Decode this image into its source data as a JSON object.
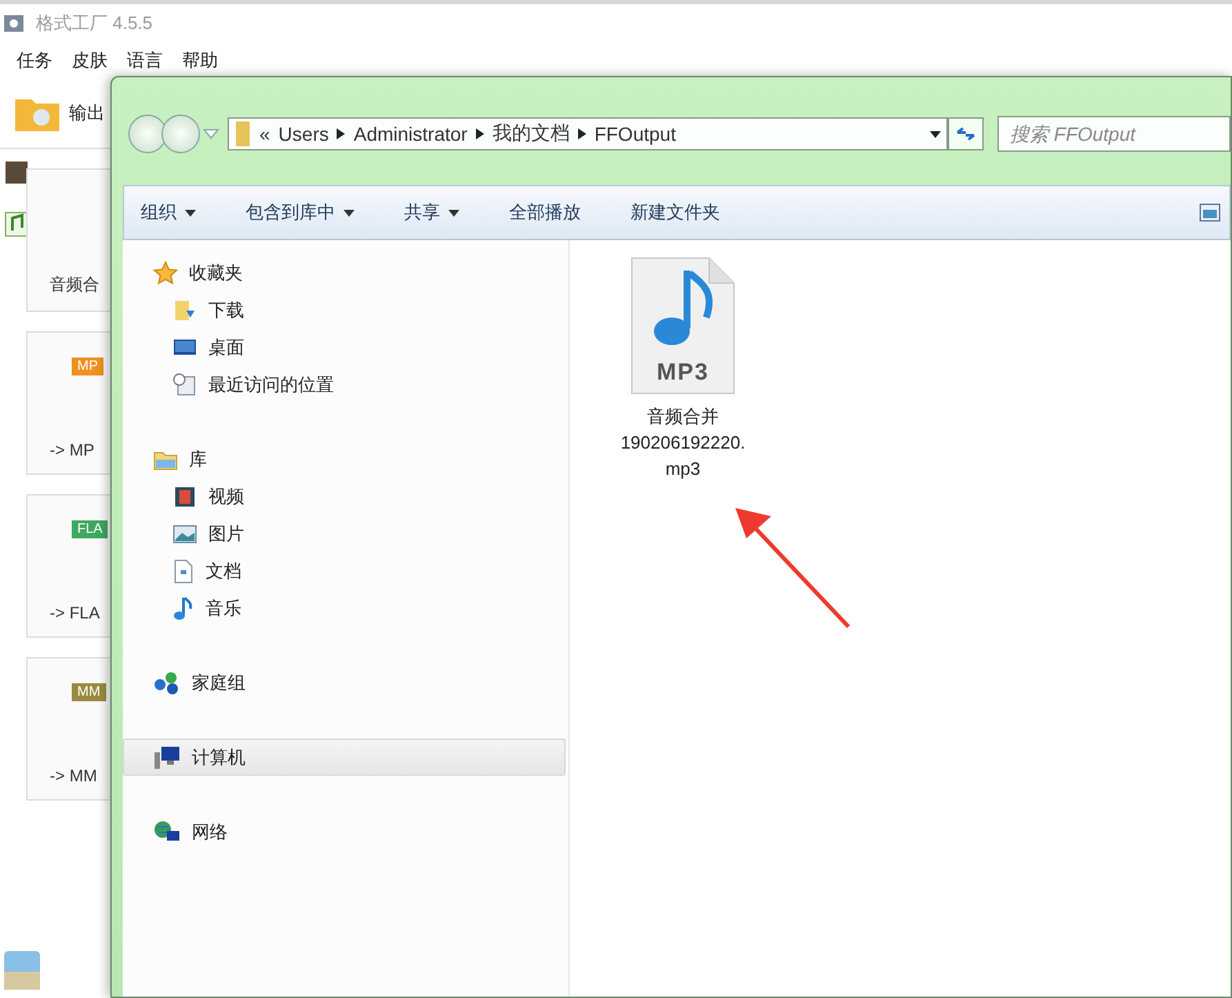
{
  "app": {
    "title": "格式工厂 4.5.5",
    "menu": [
      "任务",
      "皮肤",
      "语言",
      "帮助"
    ],
    "output_button": "输出",
    "cards": [
      {
        "kind": "merge",
        "label": "音频合"
      },
      {
        "kind": "format",
        "badge": "MP",
        "color": "#f0901e",
        "label": "-> MP"
      },
      {
        "kind": "format",
        "badge": "FLA",
        "color": "#3ea860",
        "label": "-> FLA"
      },
      {
        "kind": "format",
        "badge": "MM",
        "color": "#9a8a40",
        "label": "-> MM"
      }
    ]
  },
  "explorer": {
    "breadcrumb": {
      "overflow": "«",
      "parts": [
        "Users",
        "Administrator",
        "我的文档",
        "FFOutput"
      ]
    },
    "search": {
      "placeholder": "搜索 FFOutput"
    },
    "commands": [
      {
        "label": "组织",
        "dropdown": true
      },
      {
        "label": "包含到库中",
        "dropdown": true
      },
      {
        "label": "共享",
        "dropdown": true
      },
      {
        "label": "全部播放",
        "dropdown": false
      },
      {
        "label": "新建文件夹",
        "dropdown": false
      }
    ],
    "nav": [
      {
        "label": "收藏夹",
        "kind": "star",
        "selected": false,
        "children": [
          {
            "label": "下载",
            "kind": "download",
            "selected": false
          },
          {
            "label": "桌面",
            "kind": "desktop",
            "selected": false
          },
          {
            "label": "最近访问的位置",
            "kind": "recent",
            "selected": false
          }
        ]
      },
      {
        "label": "库",
        "kind": "library",
        "selected": false,
        "children": [
          {
            "label": "视频",
            "kind": "video",
            "selected": false
          },
          {
            "label": "图片",
            "kind": "picture",
            "selected": false
          },
          {
            "label": "文档",
            "kind": "document",
            "selected": false
          },
          {
            "label": "音乐",
            "kind": "music",
            "selected": false
          }
        ]
      },
      {
        "label": "家庭组",
        "kind": "homegroup",
        "selected": false
      },
      {
        "label": "计算机",
        "kind": "computer",
        "selected": true
      },
      {
        "label": "网络",
        "kind": "network",
        "selected": false
      }
    ],
    "files": [
      {
        "icon_label": "MP3",
        "name_lines": [
          "音频合并",
          "190206192220.",
          "mp3"
        ]
      }
    ]
  }
}
